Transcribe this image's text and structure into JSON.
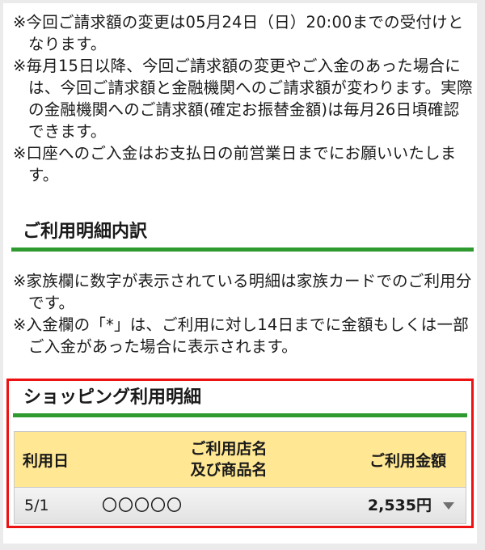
{
  "notes_top": [
    "※今回ご請求額の変更は05月24日（日）20:00までの受付けとなります。",
    "※毎月15日以降、今回ご請求額の変更やご入金のあった場合には、今回ご請求額と金融機関へのご請求額が変わります。実際の金融機関へのご請求額(確定お振替金額)は毎月26日頃確認できます。",
    "※口座へのご入金はお支払日の前営業日までにお願いいたします。"
  ],
  "breakdown": {
    "title": "ご利用明細内訳",
    "notes": [
      "※家族欄に数字が表示されている明細は家族カードでのご利用分です。",
      "※入金欄の「*」は、ご利用に対し14日までに金額もしくは一部ご入金があった場合に表示されます。"
    ]
  },
  "shopping": {
    "title": "ショッピング利用明細",
    "headers": {
      "date": "利用日",
      "store_line1": "ご利用店名",
      "store_line2": "及び商品名",
      "amount": "ご利用金額"
    },
    "rows": [
      {
        "date": "5/1",
        "store": "〇〇〇〇〇",
        "amount": "2,535円",
        "expand_icon": "caret-down-icon"
      }
    ]
  },
  "colors": {
    "accent_green": "#2f9a30",
    "highlight_red": "#ee1111",
    "header_yellow": "#ffe793"
  }
}
